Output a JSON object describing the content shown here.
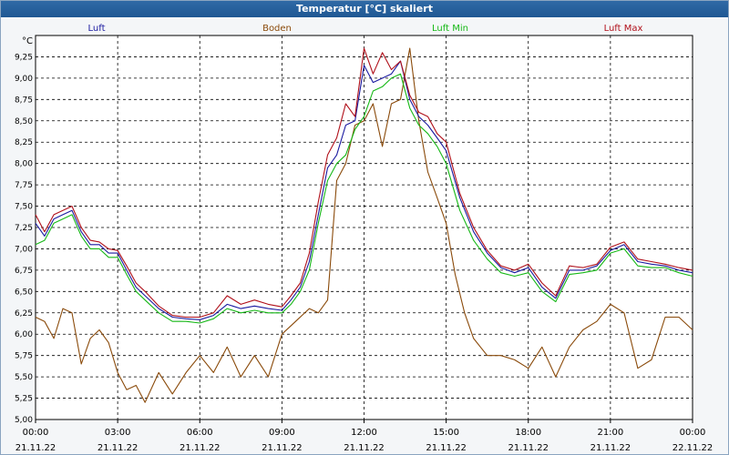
{
  "window": {
    "title": "Temperatur [°C] skaliert"
  },
  "chart_data": {
    "type": "line",
    "title": "Temperatur [°C] skaliert",
    "ylabel": "°C",
    "ylim": [
      5.0,
      9.5
    ],
    "yticks": [
      "5,00",
      "5,25",
      "5,50",
      "5,75",
      "6,00",
      "6,25",
      "6,50",
      "6,75",
      "7,00",
      "7,25",
      "7,50",
      "7,75",
      "8,00",
      "8,25",
      "8,50",
      "8,75",
      "9,00",
      "9,25"
    ],
    "xticks": [
      {
        "time": "00:00",
        "date": "21.11.22"
      },
      {
        "time": "03:00",
        "date": "21.11.22"
      },
      {
        "time": "06:00",
        "date": "21.11.22"
      },
      {
        "time": "09:00",
        "date": "21.11.22"
      },
      {
        "time": "12:00",
        "date": "21.11.22"
      },
      {
        "time": "15:00",
        "date": "21.11.22"
      },
      {
        "time": "18:00",
        "date": "21.11.22"
      },
      {
        "time": "21:00",
        "date": "21.11.22"
      },
      {
        "time": "00:00",
        "date": "22.11.22"
      }
    ],
    "xlim_hours": [
      0,
      24
    ],
    "grid": true,
    "legend_position": "top",
    "series": [
      {
        "name": "Luft",
        "color": "#1a1aa0",
        "x": [
          0,
          0.33,
          0.67,
          1,
          1.33,
          1.67,
          2,
          2.33,
          2.67,
          3,
          3.33,
          3.67,
          4,
          4.5,
          5,
          5.5,
          6,
          6.5,
          7,
          7.5,
          8,
          8.5,
          9,
          9.33,
          9.67,
          10,
          10.33,
          10.67,
          11,
          11.33,
          11.67,
          12,
          12.33,
          12.67,
          13,
          13.33,
          13.67,
          14,
          14.33,
          14.67,
          15,
          15.5,
          16,
          16.5,
          17,
          17.5,
          18,
          18.5,
          19,
          19.5,
          20,
          20.5,
          21,
          21.5,
          22,
          22.5,
          23,
          23.5,
          24
        ],
        "y": [
          7.3,
          7.15,
          7.35,
          7.4,
          7.45,
          7.2,
          7.05,
          7.05,
          6.95,
          6.95,
          6.75,
          6.55,
          6.45,
          6.3,
          6.2,
          6.18,
          6.17,
          6.22,
          6.35,
          6.3,
          6.33,
          6.3,
          6.28,
          6.4,
          6.55,
          6.85,
          7.4,
          7.95,
          8.1,
          8.45,
          8.5,
          9.15,
          8.95,
          9.0,
          9.05,
          9.2,
          8.75,
          8.55,
          8.45,
          8.3,
          8.15,
          7.6,
          7.2,
          6.95,
          6.78,
          6.72,
          6.78,
          6.55,
          6.42,
          6.75,
          6.75,
          6.8,
          6.98,
          7.05,
          6.85,
          6.82,
          6.8,
          6.75,
          6.72
        ]
      },
      {
        "name": "Boden",
        "color": "#8a4a0a",
        "x": [
          0,
          0.33,
          0.67,
          1,
          1.33,
          1.67,
          2,
          2.33,
          2.67,
          3,
          3.33,
          3.67,
          4,
          4.5,
          5,
          5.5,
          6,
          6.5,
          7,
          7.5,
          8,
          8.5,
          9,
          9.5,
          10,
          10.33,
          10.67,
          11,
          11.33,
          11.67,
          12,
          12.33,
          12.67,
          13,
          13.33,
          13.67,
          14,
          14.33,
          14.67,
          15,
          15.33,
          15.67,
          16,
          16.5,
          17,
          17.5,
          18,
          18.5,
          19,
          19.5,
          20,
          20.5,
          21,
          21.5,
          22,
          22.5,
          23,
          23.5,
          24
        ],
        "y": [
          6.2,
          6.15,
          5.95,
          6.3,
          6.25,
          5.65,
          5.95,
          6.05,
          5.9,
          5.55,
          5.35,
          5.4,
          5.2,
          5.55,
          5.3,
          5.55,
          5.75,
          5.55,
          5.85,
          5.5,
          5.75,
          5.5,
          6.0,
          6.15,
          6.3,
          6.25,
          6.4,
          7.8,
          8.0,
          8.45,
          8.5,
          8.7,
          8.2,
          8.7,
          8.75,
          9.35,
          8.5,
          7.9,
          7.6,
          7.3,
          6.7,
          6.25,
          5.95,
          5.75,
          5.75,
          5.7,
          5.6,
          5.85,
          5.5,
          5.85,
          6.05,
          6.15,
          6.35,
          6.25,
          5.6,
          5.7,
          6.2,
          6.2,
          6.05
        ]
      },
      {
        "name": "Luft Min",
        "color": "#16b816",
        "x": [
          0,
          0.33,
          0.67,
          1,
          1.33,
          1.67,
          2,
          2.33,
          2.67,
          3,
          3.33,
          3.67,
          4,
          4.5,
          5,
          5.5,
          6,
          6.5,
          7,
          7.5,
          8,
          8.5,
          9,
          9.33,
          9.67,
          10,
          10.33,
          10.67,
          11,
          11.33,
          11.67,
          12,
          12.33,
          12.67,
          13,
          13.33,
          13.67,
          14,
          14.33,
          14.67,
          15,
          15.5,
          16,
          16.5,
          17,
          17.5,
          18,
          18.5,
          19,
          19.5,
          20,
          20.5,
          21,
          21.5,
          22,
          22.5,
          23,
          23.5,
          24
        ],
        "y": [
          7.05,
          7.1,
          7.3,
          7.35,
          7.4,
          7.15,
          7.0,
          7.0,
          6.9,
          6.9,
          6.7,
          6.5,
          6.4,
          6.25,
          6.15,
          6.15,
          6.13,
          6.18,
          6.3,
          6.25,
          6.28,
          6.25,
          6.25,
          6.35,
          6.5,
          6.75,
          7.3,
          7.8,
          8.0,
          8.1,
          8.4,
          8.55,
          8.85,
          8.9,
          9.0,
          9.05,
          8.65,
          8.45,
          8.35,
          8.2,
          8.0,
          7.45,
          7.1,
          6.88,
          6.72,
          6.68,
          6.72,
          6.5,
          6.38,
          6.7,
          6.72,
          6.75,
          6.95,
          7.0,
          6.8,
          6.78,
          6.78,
          6.72,
          6.68
        ]
      },
      {
        "name": "Luft Max",
        "color": "#b0101a",
        "x": [
          0,
          0.33,
          0.67,
          1,
          1.33,
          1.67,
          2,
          2.33,
          2.67,
          3,
          3.33,
          3.67,
          4,
          4.5,
          5,
          5.5,
          6,
          6.5,
          7,
          7.5,
          8,
          8.5,
          9,
          9.33,
          9.67,
          10,
          10.33,
          10.67,
          11,
          11.33,
          11.67,
          12,
          12.33,
          12.67,
          13,
          13.33,
          13.67,
          14,
          14.33,
          14.67,
          15,
          15.5,
          16,
          16.5,
          17,
          17.5,
          18,
          18.5,
          19,
          19.5,
          20,
          20.5,
          21,
          21.5,
          22,
          22.5,
          23,
          23.5,
          24
        ],
        "y": [
          7.4,
          7.2,
          7.4,
          7.45,
          7.5,
          7.25,
          7.1,
          7.08,
          7.0,
          6.98,
          6.8,
          6.6,
          6.5,
          6.33,
          6.22,
          6.2,
          6.2,
          6.25,
          6.45,
          6.35,
          6.4,
          6.35,
          6.32,
          6.45,
          6.6,
          6.95,
          7.55,
          8.1,
          8.3,
          8.7,
          8.55,
          9.35,
          9.05,
          9.3,
          9.1,
          9.2,
          8.8,
          8.6,
          8.55,
          8.35,
          8.25,
          7.65,
          7.25,
          6.98,
          6.8,
          6.75,
          6.82,
          6.6,
          6.45,
          6.8,
          6.78,
          6.82,
          7.02,
          7.08,
          6.88,
          6.85,
          6.82,
          6.78,
          6.75
        ]
      }
    ]
  }
}
